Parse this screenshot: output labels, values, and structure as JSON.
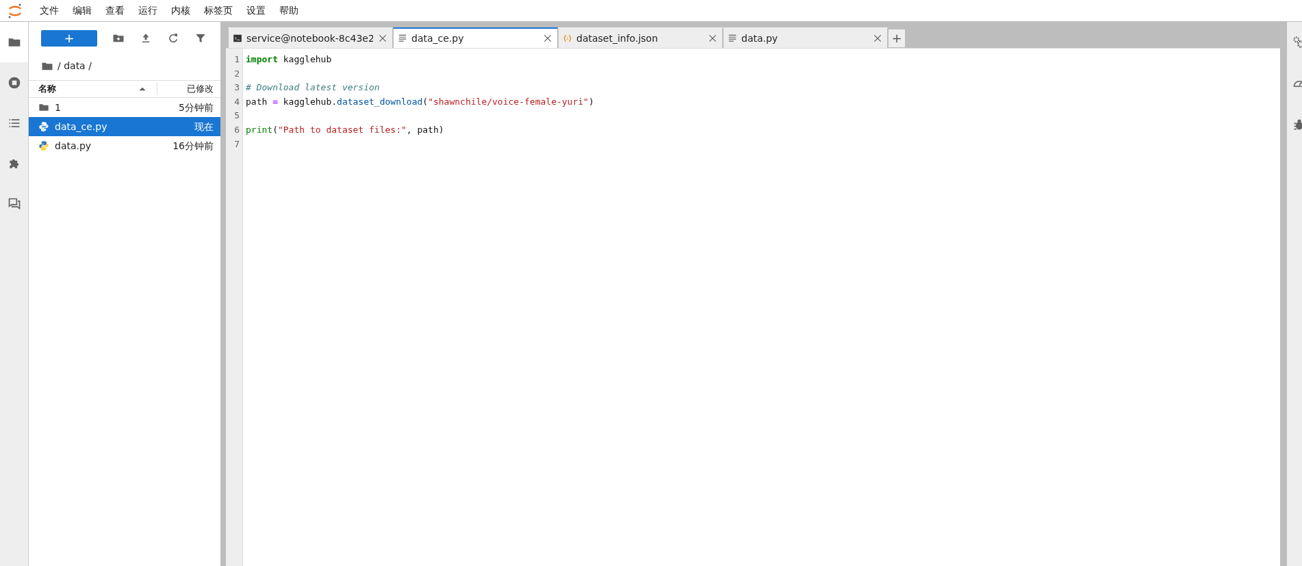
{
  "menu": [
    "文件",
    "编辑",
    "查看",
    "运行",
    "内核",
    "标签页",
    "设置",
    "帮助"
  ],
  "left_sidebar": [
    {
      "kind": "folder",
      "selected": true
    },
    {
      "kind": "stop",
      "selected": false
    },
    {
      "kind": "list",
      "selected": false
    },
    {
      "kind": "puzzle",
      "selected": false
    },
    {
      "kind": "chat",
      "selected": false
    }
  ],
  "file_browser": {
    "new_button": "+",
    "breadcrumb": "/ data /",
    "columns": {
      "name": "名称",
      "modified": "已修改"
    },
    "rows": [
      {
        "kind": "folder",
        "name": "1",
        "modified": "5分钟前",
        "selected": false
      },
      {
        "kind": "python",
        "name": "data_ce.py",
        "modified": "现在",
        "selected": true
      },
      {
        "kind": "python",
        "name": "data.py",
        "modified": "16分钟前",
        "selected": false
      }
    ]
  },
  "tabs": [
    {
      "kind": "terminal",
      "label": "service@notebook-8c43e2",
      "selected": false
    },
    {
      "kind": "text",
      "label": "data_ce.py",
      "selected": true
    },
    {
      "kind": "json",
      "label": "dataset_info.json",
      "selected": false
    },
    {
      "kind": "text",
      "label": "data.py",
      "selected": false
    }
  ],
  "add_tab": "+",
  "editor": {
    "lines": [
      {
        "number": "1",
        "tokens": [
          {
            "kind": "keyword",
            "text": "import"
          },
          {
            "kind": "plain",
            "text": " kagglehub"
          }
        ]
      },
      {
        "number": "2"
      },
      {
        "number": "3",
        "tokens": [
          {
            "kind": "comment",
            "text": "# Download latest version"
          }
        ]
      },
      {
        "number": "4",
        "tokens": [
          {
            "kind": "plain",
            "text": "path "
          },
          {
            "kind": "operator",
            "text": "="
          },
          {
            "kind": "plain",
            "text": " kagglehub."
          },
          {
            "kind": "property",
            "text": "dataset_download"
          },
          {
            "kind": "plain",
            "text": "("
          },
          {
            "kind": "string",
            "text": "\"shawnchile/voice-female-yuri\""
          },
          {
            "kind": "plain",
            "text": ")"
          }
        ]
      },
      {
        "number": "5"
      },
      {
        "number": "6",
        "tokens": [
          {
            "kind": "builtin",
            "text": "print"
          },
          {
            "kind": "plain",
            "text": "("
          },
          {
            "kind": "string",
            "text": "\"Path to dataset files:\""
          },
          {
            "kind": "plain",
            "text": ", path)"
          }
        ]
      },
      {
        "number": "7"
      }
    ]
  },
  "right_sidebar": [
    {
      "kind": "gears"
    },
    {
      "kind": "gauge"
    },
    {
      "kind": "bug"
    }
  ]
}
